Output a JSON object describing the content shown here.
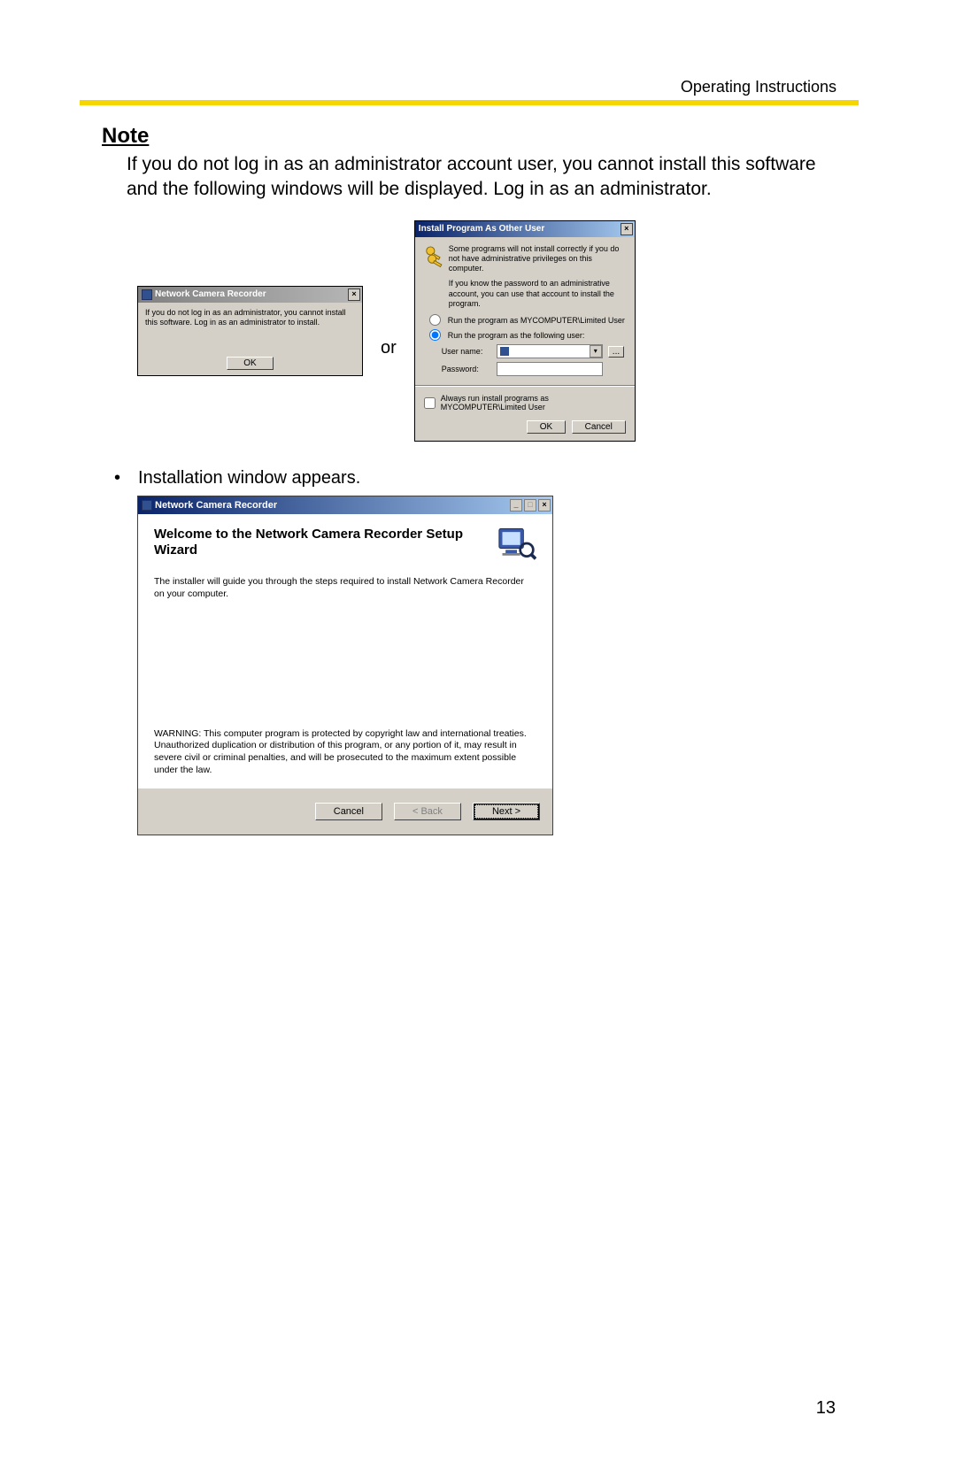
{
  "header": {
    "right": "Operating Instructions"
  },
  "note": {
    "heading": "Note",
    "body": "If you do not log in as an administrator account user, you cannot install this software and the following windows will be displayed. Log in as an administrator."
  },
  "dialog1": {
    "title": "Network Camera Recorder",
    "body": "If you do not log in as an administrator, you cannot install this software. Log in as an administrator to install.",
    "ok": "OK"
  },
  "or_label": "or",
  "dialog2": {
    "title": "Install Program As Other User",
    "line1": "Some programs will not install correctly if you do not have administrative privileges on this computer.",
    "line2": "If you know the password to an administrative account, you can use that account to install the program.",
    "radio1": "Run the program as MYCOMPUTER\\Limited User",
    "radio2": "Run the program as the following user:",
    "username_label": "User name:",
    "username_value": "",
    "password_label": "Password:",
    "always": "Always run install programs as MYCOMPUTER\\Limited User",
    "ok": "OK",
    "cancel": "Cancel"
  },
  "bullet1": "Installation window appears.",
  "dialog3": {
    "title": "Network Camera Recorder",
    "heading": "Welcome to the Network Camera Recorder Setup Wizard",
    "body": "The installer will guide you through the steps required to install Network Camera Recorder on your computer.",
    "warning": "WARNING: This computer program is protected by copyright law and international treaties. Unauthorized duplication or distribution of this program, or any portion of it, may result in severe civil or criminal penalties, and will be prosecuted to the maximum extent possible under the law.",
    "cancel": "Cancel",
    "back": "< Back",
    "next": "Next >"
  },
  "page_number": "13"
}
